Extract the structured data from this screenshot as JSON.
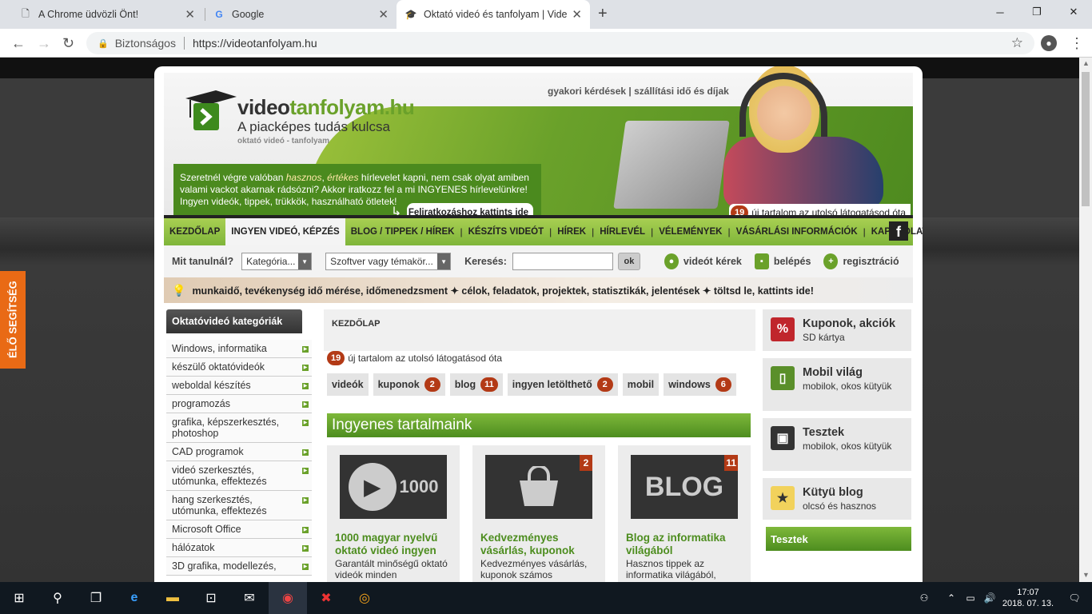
{
  "browser": {
    "tabs": [
      {
        "title": "A Chrome üdvözli Önt!",
        "icon": "page-icon"
      },
      {
        "title": "Google",
        "icon": "google-icon"
      },
      {
        "title": "Oktató videó és tanfolyam | Video",
        "icon": "graduation-cap-icon"
      }
    ],
    "security_label": "Biztonságos",
    "url": "https://videotanfolyam.hu"
  },
  "live_help": "ÉLŐ SEGÍTSÉG",
  "site": {
    "logo": {
      "part1": "video",
      "part2": "tanfolyam.hu",
      "tagline": "A piacképes tudás kulcsa",
      "small": "oktató videó - tanfolyam"
    },
    "toplinks": {
      "faq": "gyakori kérdések",
      "sep": "|",
      "shipping": "szállítási idő és díjak"
    },
    "promo": {
      "line1a": "Szeretnél végre valóban ",
      "line1b": "hasznos",
      "line1c": ", ",
      "line1d": "értékes",
      "line1e": " hírlevelet kapni, nem csak olyat amiben",
      "line2": "valami vackot akarnak rádsózni? Akkor iratkozz fel a mi INGYENES hírlevelünkre!",
      "line3": "Ingyen videók, tippek, trükkök, használható ötletek!",
      "button": "Feliratkozáshoz kattints ide"
    },
    "new_count": {
      "count": "19",
      "text": "új tartalom az utolsó látogatásod óta"
    },
    "nav": [
      "KEZDŐLAP",
      "INGYEN VIDEÓ, KÉPZÉS",
      "BLOG / TIPPEK / HÍREK",
      "KÉSZÍTS VIDEÓT",
      "HÍREK",
      "HÍRLEVÉL",
      "VÉLEMÉNYEK",
      "VÁSÁRLÁSI INFORMÁCIÓK",
      "KAPCSOLAT"
    ],
    "search": {
      "label": "Mit tanulnál?",
      "category": "Kategória...",
      "topic": "Szoftver vagy témakör...",
      "search_label": "Keresés:",
      "ok": "ok",
      "request": "videót kérek",
      "login": "belépés",
      "register": "regisztráció"
    },
    "ticker": "munkaidő, tevékenység idő mérése, időmenedzsment ✦ célok, feladatok, projektek, statisztikák, jelentések ✦ töltsd le, kattints ide!",
    "categories_title": "Oktatóvideó kategóriák",
    "categories": [
      "Windows, informatika",
      "készülő oktatóvideók",
      "weboldal készítés",
      "programozás",
      "grafika, képszerkesztés, photoshop",
      "CAD programok",
      "videó szerkesztés, utómunka, effektezés",
      "hang szerkesztés, utómunka, effektezés",
      "Microsoft Office",
      "hálózatok",
      "3D grafika, modellezés,"
    ],
    "breadcrumb": "KEZDŐLAP",
    "mid_new": {
      "count": "19",
      "text": "új tartalom az utolsó látogatásod óta"
    },
    "tags": [
      {
        "label": "videók",
        "count": ""
      },
      {
        "label": "kuponok",
        "count": "2"
      },
      {
        "label": "blog",
        "count": "11"
      },
      {
        "label": "ingyen letölthető",
        "count": "2"
      },
      {
        "label": "mobil",
        "count": ""
      },
      {
        "label": "windows",
        "count": "6"
      }
    ],
    "section_title": "Ingyenes tartalmaink",
    "cards": [
      {
        "thumb": "1000",
        "badge": "",
        "title": "1000 magyar nyelvű oktató videó ingyen",
        "desc": "Garantált minőségű oktató videók minden"
      },
      {
        "thumb": "",
        "badge": "2",
        "title": "Kedvezményes vásárlás, kuponok",
        "desc": "Kedvezményes vásárlás, kuponok számos"
      },
      {
        "thumb": "BLOG",
        "badge": "11",
        "title": "Blog az informatika világából",
        "desc": "Hasznos tippek az informatika világából,"
      }
    ],
    "right": [
      {
        "icon": "%",
        "title": "Kuponok, akciók",
        "sub": "SD kártya",
        "color": "#c0262c"
      },
      {
        "icon": "▯",
        "title": "Mobil világ",
        "sub": "mobilok, okos kütyük",
        "color": "#5a8f2a"
      },
      {
        "icon": "▣",
        "title": "Tesztek",
        "sub": "mobilok, okos kütyük",
        "color": "#333333"
      },
      {
        "icon": "★",
        "title": "Kütyü blog",
        "sub": "olcsó és hasznos",
        "color": "#f2d25c"
      }
    ],
    "tests_label": "Tesztek"
  },
  "taskbar": {
    "time": "17:07",
    "date": "2018. 07. 13."
  }
}
